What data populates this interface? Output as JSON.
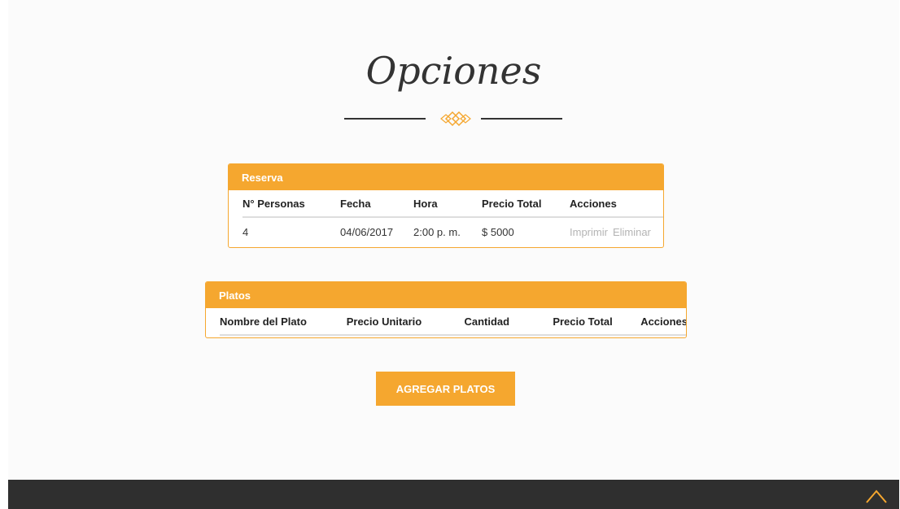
{
  "page": {
    "title": "Opciones"
  },
  "reserva": {
    "header": "Reserva",
    "columns": [
      "N° Personas",
      "Fecha",
      "Hora",
      "Precio Total",
      "Acciones"
    ],
    "rows": [
      {
        "personas": "4",
        "fecha": "04/06/2017",
        "hora": "2:00 p. m.",
        "precio": "$ 5000",
        "imprimir": "Imprimir",
        "eliminar": "Eliminar"
      }
    ]
  },
  "platos": {
    "header": "Platos",
    "columns": [
      "Nombre del Plato",
      "Precio Unitario",
      "Cantidad",
      "Precio Total",
      "Acciones"
    ]
  },
  "actions": {
    "add_platos": "AGREGAR PLATOS"
  },
  "footer": {
    "scroll_top_icon": "chevron-up-icon"
  },
  "colors": {
    "accent": "#f5a72f",
    "footer": "#2f2f2f",
    "muted": "#b4b4b4"
  }
}
